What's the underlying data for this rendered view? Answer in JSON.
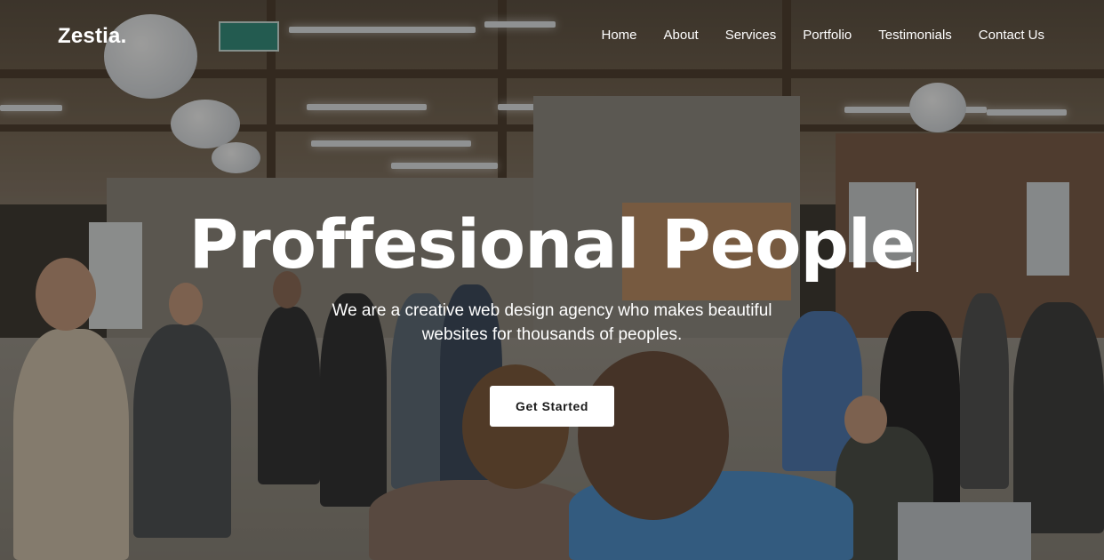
{
  "brand": {
    "logo_text": "Zestia."
  },
  "nav": {
    "items": [
      {
        "label": "Home"
      },
      {
        "label": "About"
      },
      {
        "label": "Services"
      },
      {
        "label": "Portfolio"
      },
      {
        "label": "Testimonials"
      },
      {
        "label": "Contact Us"
      }
    ]
  },
  "hero": {
    "title": "Proffesional People",
    "subtitle": "We are a creative web design agency who makes beautiful websites for thousands of peoples.",
    "cta_label": "Get Started",
    "background_icon": "office-team-photo",
    "overlay_color": "#141210"
  },
  "colors": {
    "text": "#ffffff",
    "button_bg": "#ffffff",
    "button_text": "#1a1a1a"
  }
}
